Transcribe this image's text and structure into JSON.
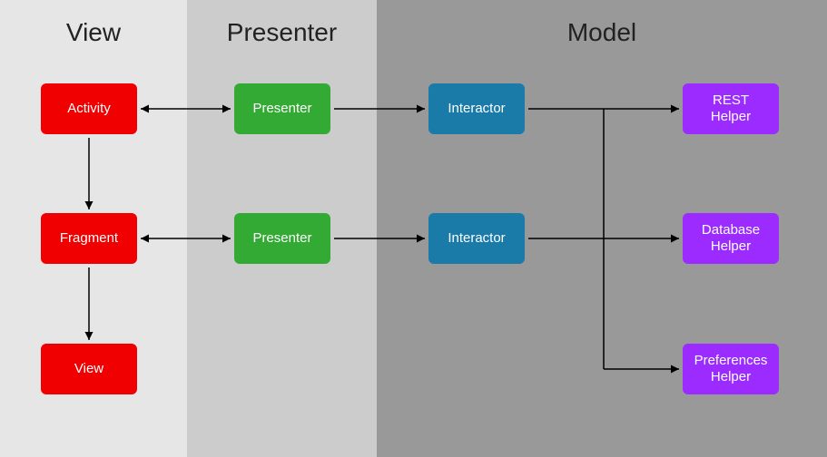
{
  "diagram": {
    "columns": {
      "view": {
        "title": "View"
      },
      "presenter": {
        "title": "Presenter"
      },
      "model": {
        "title": "Model"
      }
    },
    "nodes": {
      "activity": {
        "label": "Activity",
        "column": "view",
        "color": "red"
      },
      "fragment": {
        "label": "Fragment",
        "column": "view",
        "color": "red"
      },
      "view": {
        "label": "View",
        "column": "view",
        "color": "red"
      },
      "presenter1": {
        "label": "Presenter",
        "column": "presenter",
        "color": "green"
      },
      "presenter2": {
        "label": "Presenter",
        "column": "presenter",
        "color": "green"
      },
      "interactor1": {
        "label": "Interactor",
        "column": "model",
        "color": "blue"
      },
      "interactor2": {
        "label": "Interactor",
        "column": "model",
        "color": "blue"
      },
      "rest_helper": {
        "label": "REST\nHelper",
        "column": "model",
        "color": "purple"
      },
      "database_helper": {
        "label": "Database\nHelper",
        "column": "model",
        "color": "purple"
      },
      "preferences_helper": {
        "label": "Preferences\nHelper",
        "column": "model",
        "color": "purple"
      }
    },
    "edges": [
      {
        "from": "activity",
        "to": "presenter1",
        "bidirectional": true
      },
      {
        "from": "activity",
        "to": "fragment",
        "bidirectional": false
      },
      {
        "from": "fragment",
        "to": "view",
        "bidirectional": false
      },
      {
        "from": "fragment",
        "to": "presenter2",
        "bidirectional": true
      },
      {
        "from": "presenter1",
        "to": "interactor1",
        "bidirectional": false
      },
      {
        "from": "presenter2",
        "to": "interactor2",
        "bidirectional": false
      },
      {
        "from": "interactor1",
        "to": "rest_helper",
        "bidirectional": false
      },
      {
        "from": "interactor1",
        "to": "database_helper",
        "bidirectional": false
      },
      {
        "from": "interactor1",
        "to": "preferences_helper",
        "bidirectional": false
      },
      {
        "from": "interactor2",
        "to": "rest_helper",
        "bidirectional": false
      },
      {
        "from": "interactor2",
        "to": "database_helper",
        "bidirectional": false
      },
      {
        "from": "interactor2",
        "to": "preferences_helper",
        "bidirectional": false
      }
    ]
  }
}
